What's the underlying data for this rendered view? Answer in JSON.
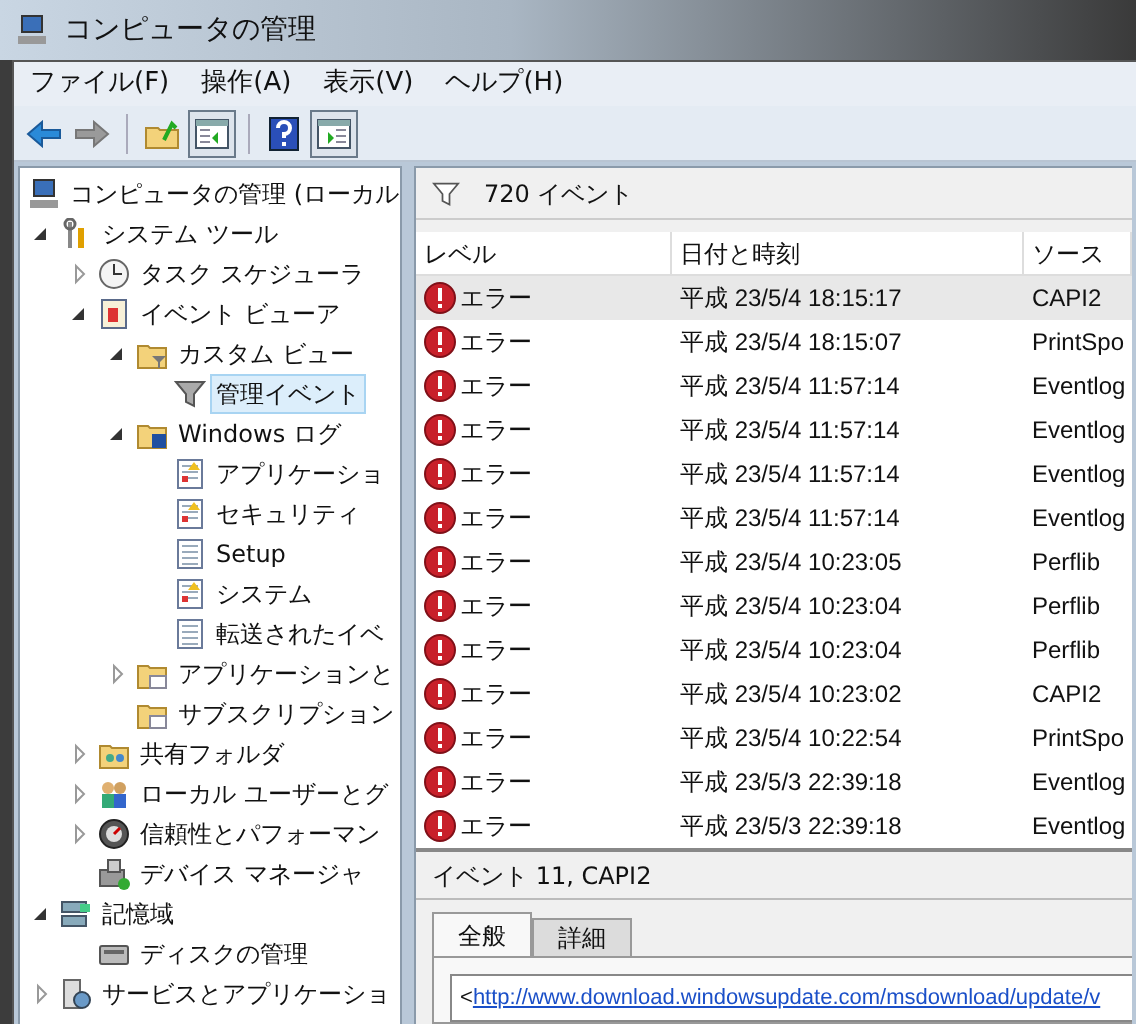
{
  "window": {
    "title": "コンピュータの管理"
  },
  "menu": [
    "ファイル(F)",
    "操作(A)",
    "表示(V)",
    "ヘルプ(H)"
  ],
  "toolbar": [
    {
      "kind": "back",
      "disabled": false
    },
    {
      "kind": "forward",
      "disabled": true
    },
    {
      "kind": "separator"
    },
    {
      "kind": "up",
      "disabled": false
    },
    {
      "kind": "tree-toggle",
      "pressed": true
    },
    {
      "kind": "separator"
    },
    {
      "kind": "help",
      "disabled": false
    },
    {
      "kind": "action-toggle",
      "pressed": true
    }
  ],
  "tree": [
    {
      "label": "コンピュータの管理 (ローカル",
      "kind": "computer",
      "selected": false,
      "children": [
        {
          "label": "システム ツール",
          "kind": "tools",
          "expanded": true,
          "selected": false,
          "children": [
            {
              "label": "タスク スケジューラ",
              "kind": "clock",
              "expanded": false,
              "selected": false
            },
            {
              "label": "イベント ビューア",
              "kind": "viewer",
              "expanded": true,
              "selected": false,
              "children": [
                {
                  "label": "カスタム ビュー",
                  "kind": "filter-folder",
                  "expanded": true,
                  "selected": false,
                  "children": [
                    {
                      "label": "管理イベント",
                      "kind": "filter",
                      "selected": true
                    }
                  ]
                },
                {
                  "label": "Windows ログ",
                  "kind": "log-folder",
                  "expanded": true,
                  "selected": false,
                  "children": [
                    {
                      "label": "アプリケーショ",
                      "kind": "log",
                      "selected": false
                    },
                    {
                      "label": "セキュリティ",
                      "kind": "log",
                      "selected": false
                    },
                    {
                      "label": "Setup",
                      "kind": "plain-log",
                      "selected": false
                    },
                    {
                      "label": "システム",
                      "kind": "log",
                      "selected": false
                    },
                    {
                      "label": "転送されたイベ",
                      "kind": "plain-log",
                      "selected": false
                    }
                  ]
                },
                {
                  "label": "アプリケーションと",
                  "kind": "folder",
                  "expanded": false,
                  "selected": false
                },
                {
                  "label": "サブスクリプション",
                  "kind": "folder",
                  "selected": false
                }
              ]
            },
            {
              "label": "共有フォルダ",
              "kind": "share",
              "expanded": false,
              "selected": false
            },
            {
              "label": "ローカル ユーザーとグ",
              "kind": "users",
              "expanded": false,
              "selected": false
            },
            {
              "label": "信頼性とパフォーマン",
              "kind": "gauge",
              "expanded": false,
              "selected": false
            },
            {
              "label": "デバイス マネージャ",
              "kind": "device",
              "selected": false
            }
          ]
        },
        {
          "label": "記憶域",
          "kind": "storage",
          "expanded": true,
          "selected": false,
          "children": [
            {
              "label": "ディスクの管理",
              "kind": "disk",
              "selected": false
            }
          ]
        },
        {
          "label": "サービスとアプリケーショ",
          "kind": "services",
          "expanded": false,
          "selected": false
        }
      ]
    }
  ],
  "events": {
    "count_label": "720 イベント",
    "columns": [
      "レベル",
      "日付と時刻",
      "ソース"
    ],
    "rows": [
      {
        "level": "エラー",
        "date": "平成 23/5/4 18:15:17",
        "source": "CAPI2",
        "selected": true
      },
      {
        "level": "エラー",
        "date": "平成 23/5/4 18:15:07",
        "source": "PrintSpo",
        "selected": false
      },
      {
        "level": "エラー",
        "date": "平成 23/5/4 11:57:14",
        "source": "Eventlog",
        "selected": false
      },
      {
        "level": "エラー",
        "date": "平成 23/5/4 11:57:14",
        "source": "Eventlog",
        "selected": false
      },
      {
        "level": "エラー",
        "date": "平成 23/5/4 11:57:14",
        "source": "Eventlog",
        "selected": false
      },
      {
        "level": "エラー",
        "date": "平成 23/5/4 11:57:14",
        "source": "Eventlog",
        "selected": false
      },
      {
        "level": "エラー",
        "date": "平成 23/5/4 10:23:05",
        "source": "Perflib",
        "selected": false
      },
      {
        "level": "エラー",
        "date": "平成 23/5/4 10:23:04",
        "source": "Perflib",
        "selected": false
      },
      {
        "level": "エラー",
        "date": "平成 23/5/4 10:23:04",
        "source": "Perflib",
        "selected": false
      },
      {
        "level": "エラー",
        "date": "平成 23/5/4 10:23:02",
        "source": "CAPI2",
        "selected": false
      },
      {
        "level": "エラー",
        "date": "平成 23/5/4 10:22:54",
        "source": "PrintSpo",
        "selected": false
      },
      {
        "level": "エラー",
        "date": "平成 23/5/3 22:39:18",
        "source": "Eventlog",
        "selected": false
      },
      {
        "level": "エラー",
        "date": "平成 23/5/3 22:39:18",
        "source": "Eventlog",
        "selected": false
      }
    ]
  },
  "detail": {
    "title": "イベント 11, CAPI2",
    "tabs": [
      {
        "label": "全般",
        "selected": true
      },
      {
        "label": "詳細",
        "selected": false
      }
    ],
    "prefix": "<",
    "link": "http://www.download.windowsupdate.com/msdownload/update/v"
  }
}
